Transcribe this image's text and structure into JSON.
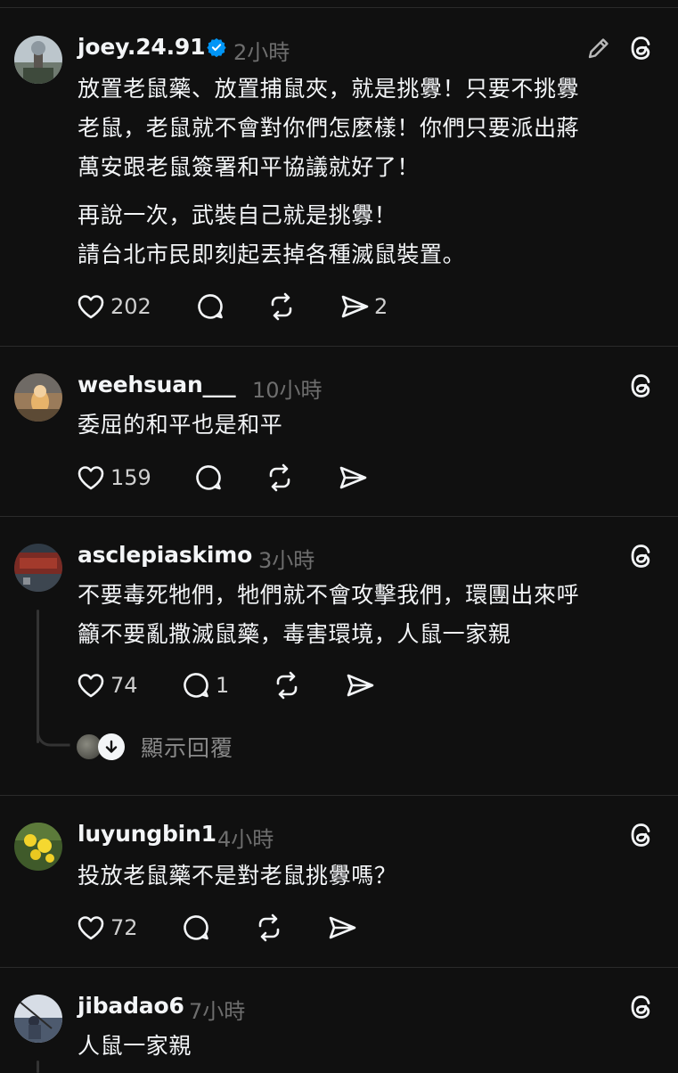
{
  "posts": [
    {
      "username": "joey.24.91",
      "verified": true,
      "time": "2小時",
      "lines": [
        "放置老鼠藥、放置捕鼠夾，就是挑釁！只要不挑釁",
        "老鼠，老鼠就不會對你們怎麼樣！你們只要派出蔣",
        "萬安跟老鼠簽署和平協議就好了！",
        "再說一次，武裝自己就是挑釁！",
        "請台北市民即刻起丟掉各種滅鼠裝置。"
      ],
      "likes": "202",
      "reposts_shares": "2"
    },
    {
      "username": "weehsuan___",
      "time": "10小時",
      "lines": [
        "委屈的和平也是和平"
      ],
      "likes": "159"
    },
    {
      "username": "asclepiaskimo",
      "time": "3小時",
      "lines": [
        "不要毒死牠們，牠們就不會攻擊我們，環團出來呼",
        "籲不要亂撒滅鼠藥，毒害環境，人鼠一家親"
      ],
      "likes": "74",
      "replies": "1",
      "show_replies": "顯示回覆"
    },
    {
      "username": "luyungbin1",
      "time": "4小時",
      "lines": [
        "投放老鼠藥不是對老鼠挑釁嗎？"
      ],
      "likes": "72"
    },
    {
      "username": "jibadao6",
      "time": "7小時",
      "lines": [
        "人鼠一家親"
      ]
    }
  ],
  "icons": {
    "like": "heart-icon",
    "reply": "comment-icon",
    "repost": "repost-icon",
    "share": "send-icon",
    "threads": "threads-logo-icon",
    "edit": "pencil-icon",
    "verified": "verified-badge-icon"
  },
  "colors": {
    "background": "#101010",
    "text": "#f3f5f7",
    "muted": "#6e6e6e",
    "verified": "#0095f6"
  }
}
